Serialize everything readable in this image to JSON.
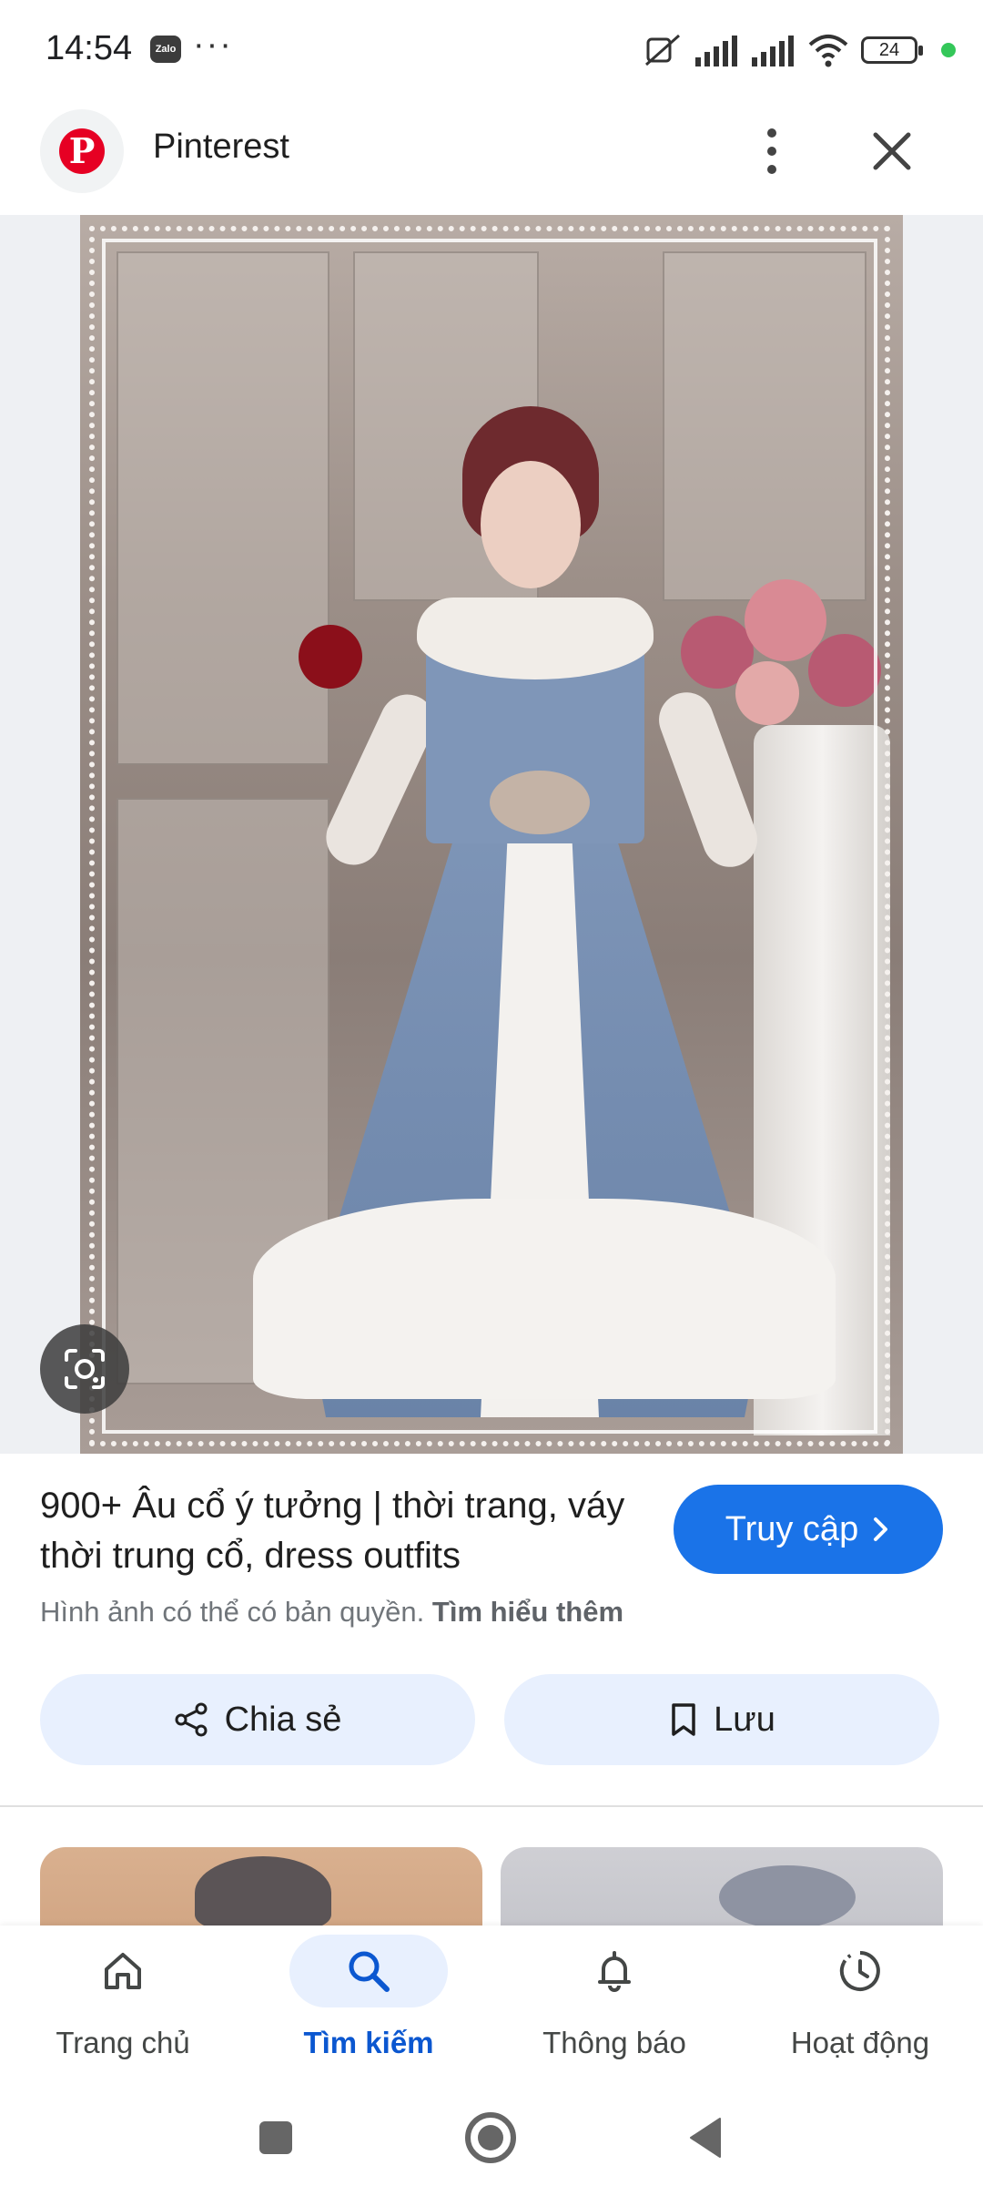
{
  "status_bar": {
    "time": "14:54",
    "notification_icons": [
      "zalo-icon",
      "more-dots-icon"
    ],
    "zalo_label": "Zalo",
    "dots": "···",
    "battery_level": "24",
    "system_icons": [
      "mute-vibrate-icon",
      "signal-icon",
      "signal-icon",
      "wifi-icon",
      "battery-icon"
    ]
  },
  "header": {
    "site_name": "Pinterest",
    "logo_letter": "P",
    "icons": [
      "pinterest-logo-icon",
      "more-vert-icon",
      "close-icon"
    ]
  },
  "image_viewer": {
    "lens_icon": "google-lens-icon"
  },
  "result": {
    "title": "900+ Âu cổ ý tưởng | thời trang, váy thời trung cổ, dress outfits",
    "visit_label": "Truy cập",
    "copyright_text": "Hình ảnh có thể có bản quyền.",
    "learn_more_label": "Tìm hiểu thêm"
  },
  "actions": {
    "share_label": "Chia sẻ",
    "save_label": "Lưu"
  },
  "bottom_nav": {
    "items": [
      {
        "label": "Trang chủ",
        "icon": "home-icon",
        "active": false
      },
      {
        "label": "Tìm kiếm",
        "icon": "search-icon",
        "active": true
      },
      {
        "label": "Thông báo",
        "icon": "bell-icon",
        "active": false
      },
      {
        "label": "Hoạt động",
        "icon": "activity-icon",
        "active": false
      }
    ]
  },
  "colors": {
    "accent": "#1a73e8",
    "active_nav": "#0b57d0",
    "tonal_button": "#e8f0fe",
    "pinterest_red": "#e60023"
  }
}
